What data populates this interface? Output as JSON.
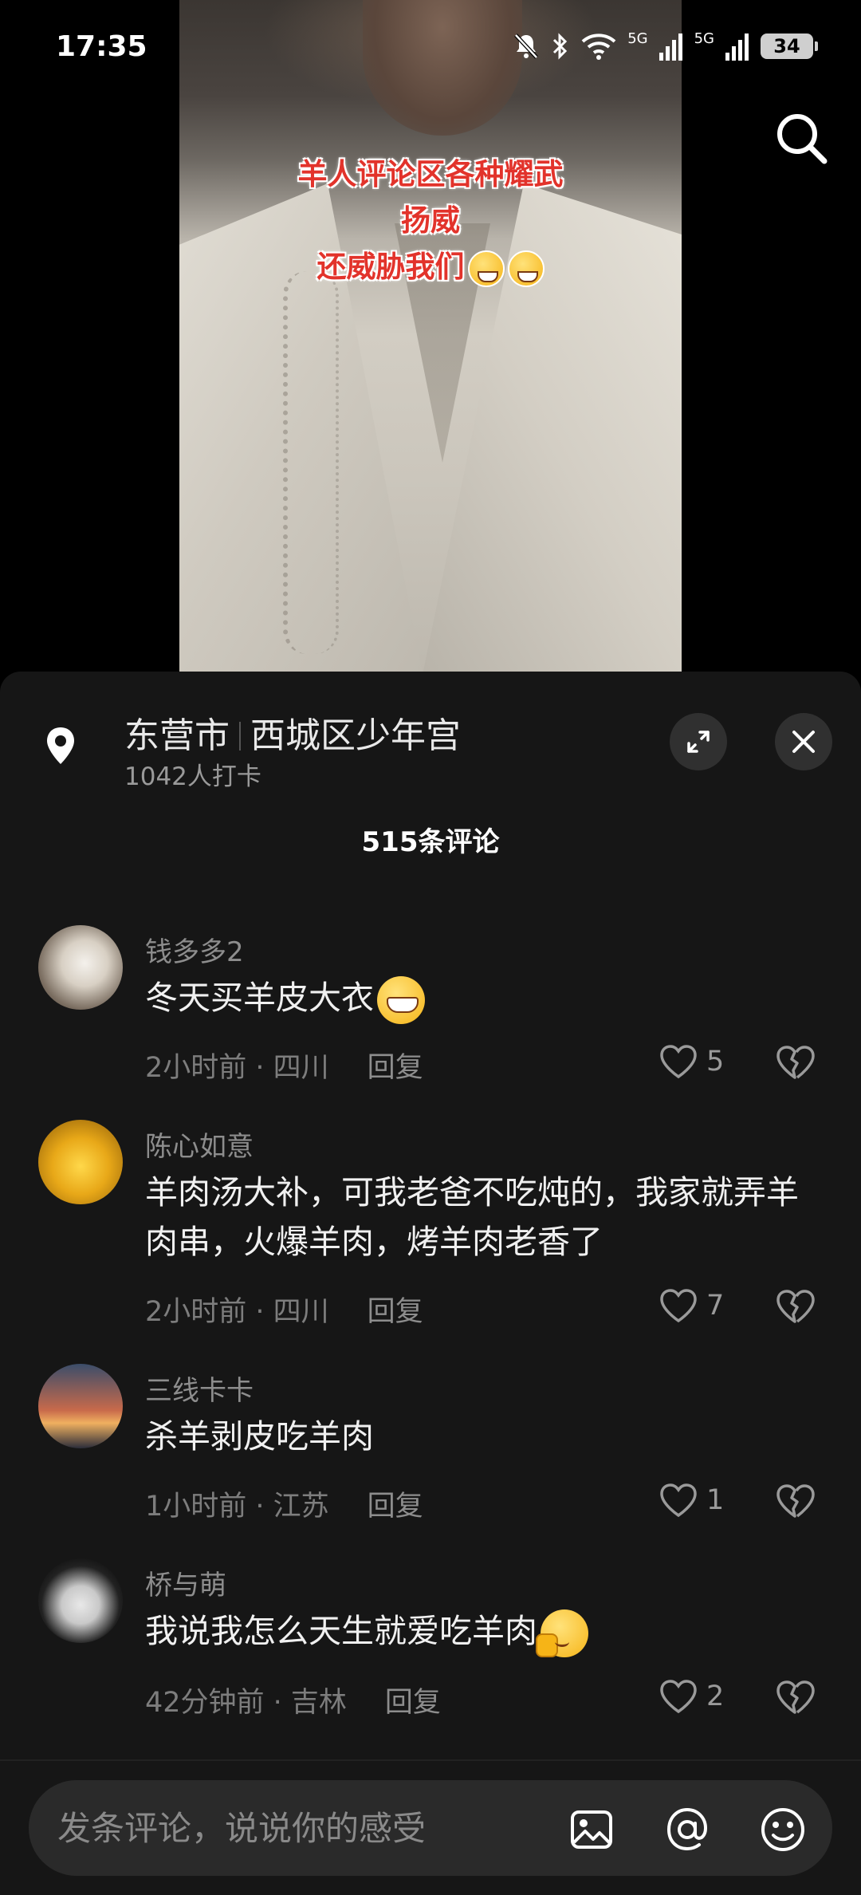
{
  "status_bar": {
    "time": "17:35",
    "network_1": "5G",
    "network_2": "5G",
    "battery": "34"
  },
  "video": {
    "caption_lines": [
      "羊人评论区各种耀武",
      "扬威",
      "还威胁我们"
    ]
  },
  "location": {
    "city": "东营市",
    "place": "西城区少年宫",
    "checkins": "1042人打卡"
  },
  "comments_header": {
    "count_label": "515条评论"
  },
  "comments": [
    {
      "user": "钱多多2",
      "text": "冬天买羊皮大衣",
      "emoji": "grin-emoji",
      "meta": "2小时前 · 四川",
      "reply": "回复",
      "likes": "5"
    },
    {
      "user": "陈心如意",
      "text": "羊肉汤大补，可我老爸不吃炖的，我家就弄羊肉串，火爆羊肉，烤羊肉老香了",
      "emoji": "",
      "meta": "2小时前 · 四川",
      "reply": "回复",
      "likes": "7"
    },
    {
      "user": "三线卡卡",
      "text": "杀羊剥皮吃羊肉",
      "emoji": "",
      "meta": "1小时前 · 江苏",
      "reply": "回复",
      "likes": "1"
    },
    {
      "user": "桥与萌",
      "text": "我说我怎么天生就爱吃羊肉",
      "emoji": "blessed-emoji",
      "meta": "42分钟前 · 吉林",
      "reply": "回复",
      "likes": "2"
    }
  ],
  "input": {
    "placeholder": "发条评论，说说你的感受"
  },
  "colors": {
    "sheet_bg": "#161616",
    "caption_red": "#e2332b",
    "input_bg": "#2a2a2a"
  }
}
